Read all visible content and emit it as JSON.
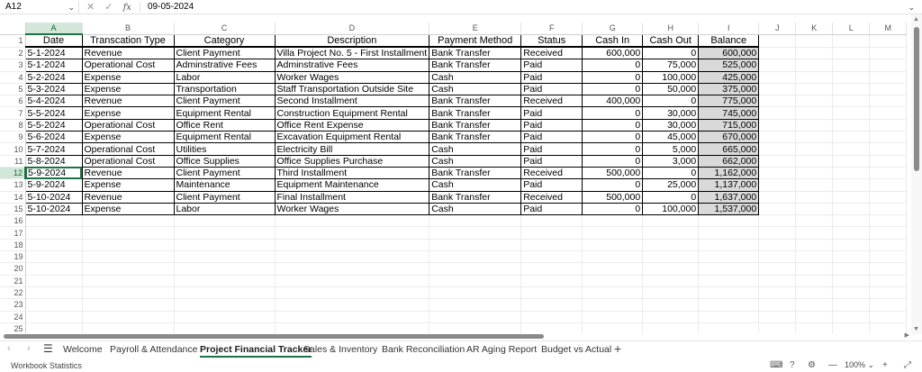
{
  "formula_bar": {
    "name_box": "A12",
    "cancel_icon": "✕",
    "enter_icon": "✓",
    "fx_label": "fx",
    "value": "09-05-2024"
  },
  "sheet": {
    "columns": [
      "A",
      "B",
      "C",
      "D",
      "E",
      "F",
      "G",
      "H",
      "I",
      "J",
      "K",
      "L",
      "M"
    ],
    "selected_column": "A",
    "selected_row": 12,
    "total_rows": 25,
    "headers": [
      "Date",
      "Transcation Type",
      "Category",
      "Description",
      "Payment Method",
      "Status",
      "Cash In",
      "Cash Out",
      "Balance"
    ],
    "rows": [
      [
        "5-1-2024",
        "Revenue",
        "Client Payment",
        "Villa Project No. 5 - First Installment",
        "Bank Transfer",
        "Received",
        "600,000",
        "0",
        "600,000"
      ],
      [
        "5-1-2024",
        "Operational Cost",
        "Adminstrative Fees",
        "Adminstrative Fees",
        "Bank Transfer",
        "Paid",
        "0",
        "75,000",
        "525,000"
      ],
      [
        "5-2-2024",
        "Expense",
        "Labor",
        "Worker Wages",
        "Cash",
        "Paid",
        "0",
        "100,000",
        "425,000"
      ],
      [
        "5-3-2024",
        "Expense",
        "Transportation",
        "Staff Transportation Outside Site",
        "Cash",
        "Paid",
        "0",
        "50,000",
        "375,000"
      ],
      [
        "5-4-2024",
        "Revenue",
        "Client Payment",
        "Second Installment",
        "Bank Transfer",
        "Received",
        "400,000",
        "0",
        "775,000"
      ],
      [
        "5-5-2024",
        "Expense",
        "Equipment Rental",
        "Construction Equipment Rental",
        "Bank Transfer",
        "Paid",
        "0",
        "30,000",
        "745,000"
      ],
      [
        "5-5-2024",
        "Operational Cost",
        "Office Rent",
        "Office Rent Expense",
        "Bank Transfer",
        "Paid",
        "0",
        "30,000",
        "715,000"
      ],
      [
        "5-6-2024",
        "Expense",
        "Equipment Rental",
        "Excavation Equipment Rental",
        "Bank Transfer",
        "Paid",
        "0",
        "45,000",
        "670,000"
      ],
      [
        "5-7-2024",
        "Operational Cost",
        "Utilities",
        "Electricity Bill",
        "Cash",
        "Paid",
        "0",
        "5,000",
        "665,000"
      ],
      [
        "5-8-2024",
        "Operational Cost",
        "Office Supplies",
        "Office Supplies Purchase",
        "Cash",
        "Paid",
        "0",
        "3,000",
        "662,000"
      ],
      [
        "5-9-2024",
        "Revenue",
        "Client Payment",
        "Third Installment",
        "Bank Transfer",
        "Received",
        "500,000",
        "0",
        "1,162,000"
      ],
      [
        "5-9-2024",
        "Expense",
        "Maintenance",
        "Equipment Maintenance",
        "Cash",
        "Paid",
        "0",
        "25,000",
        "1,137,000"
      ],
      [
        "5-10-2024",
        "Revenue",
        "Client Payment",
        "Final Installment",
        "Bank Transfer",
        "Received",
        "500,000",
        "0",
        "1,637,000"
      ],
      [
        "5-10-2024",
        "Expense",
        "Labor",
        "Worker Wages",
        "Cash",
        "Paid",
        "0",
        "100,000",
        "1,537,000"
      ]
    ]
  },
  "tabs": [
    {
      "label": "Welcome",
      "active": false
    },
    {
      "label": "Payroll & Attendance",
      "active": false
    },
    {
      "label": "Project Financial Tracker",
      "active": true
    },
    {
      "label": "Sales & Inventory",
      "active": false
    },
    {
      "label": "Bank Reconciliation",
      "active": false
    },
    {
      "label": "AR Aging Report",
      "active": false
    },
    {
      "label": "Budget vs Actual",
      "active": false
    }
  ],
  "status_bar": {
    "left_text": "Workbook Statistics",
    "zoom": "100%",
    "zoom_out": "—",
    "zoom_in": "+"
  },
  "colors": {
    "accent": "#1e7145",
    "selected_header_bg": "#d3e7d9",
    "balance_fill": "#d9d9d9"
  }
}
